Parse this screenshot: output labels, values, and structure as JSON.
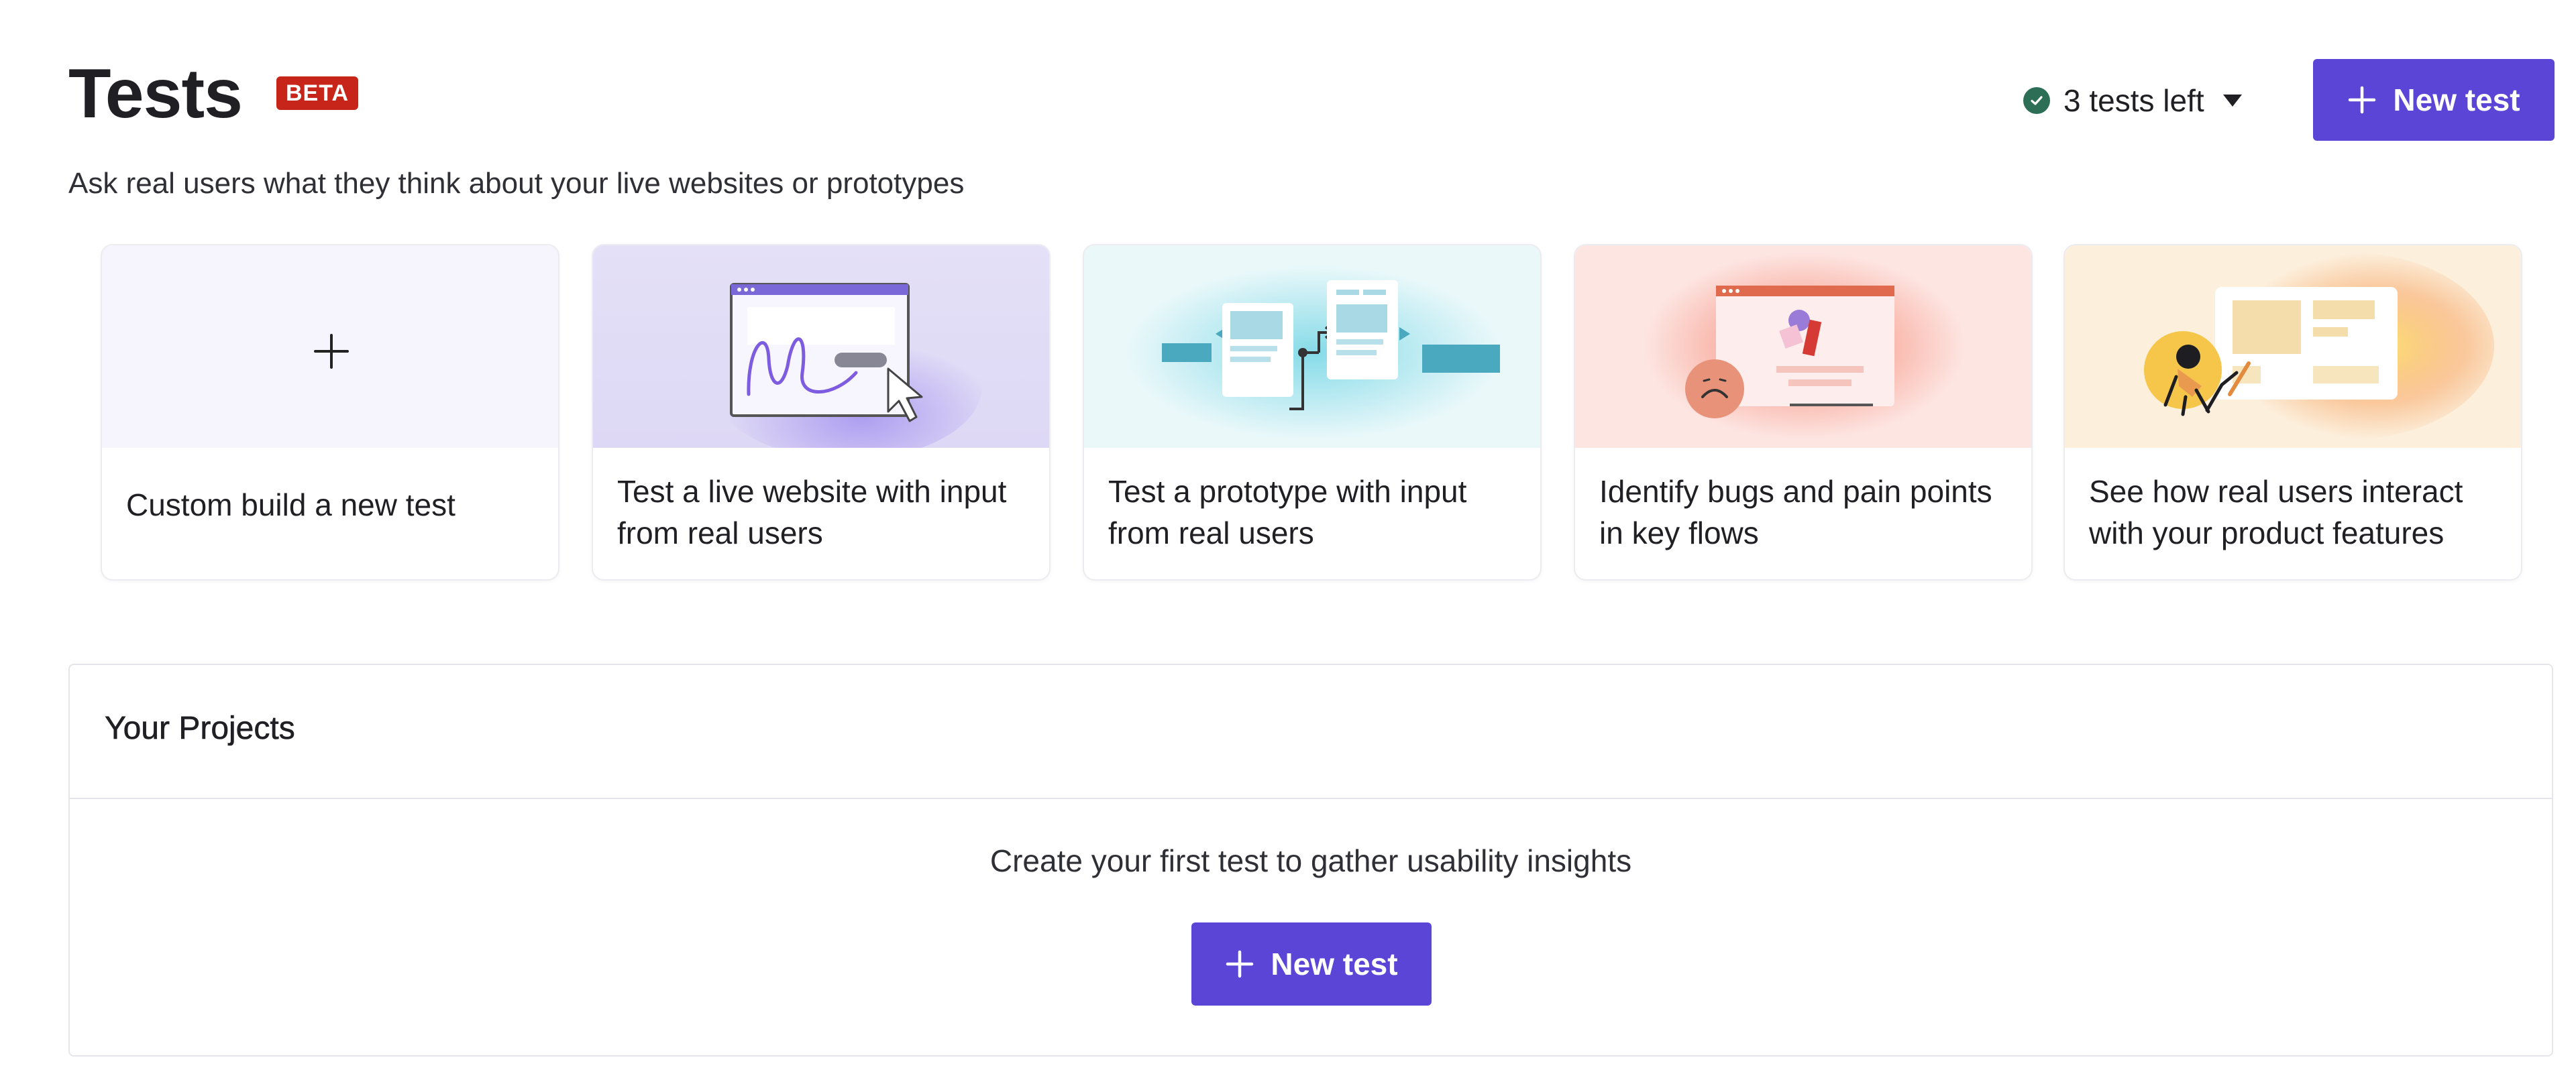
{
  "header": {
    "title": "Tests",
    "badge": "BETA",
    "subtitle": "Ask real users what they think about your live websites or prototypes",
    "tests_left": "3 tests left",
    "new_test_label": "New test"
  },
  "cards": [
    {
      "caption": "Custom build a new test",
      "icon": "plus-icon"
    },
    {
      "caption": "Test a live website with input from real users",
      "icon": "website-illustration"
    },
    {
      "caption": "Test a prototype with input from real users",
      "icon": "prototype-illustration"
    },
    {
      "caption": "Identify bugs and pain points in key flows",
      "icon": "bugs-illustration"
    },
    {
      "caption": "See how real users interact with your product features",
      "icon": "features-illustration"
    }
  ],
  "projects": {
    "title": "Your Projects",
    "empty_text": "Create your first test to gather usability insights",
    "new_test_label": "New test"
  },
  "colors": {
    "primary": "#5a45d6",
    "badge": "#c8251a",
    "status_ok": "#2c6e56"
  }
}
